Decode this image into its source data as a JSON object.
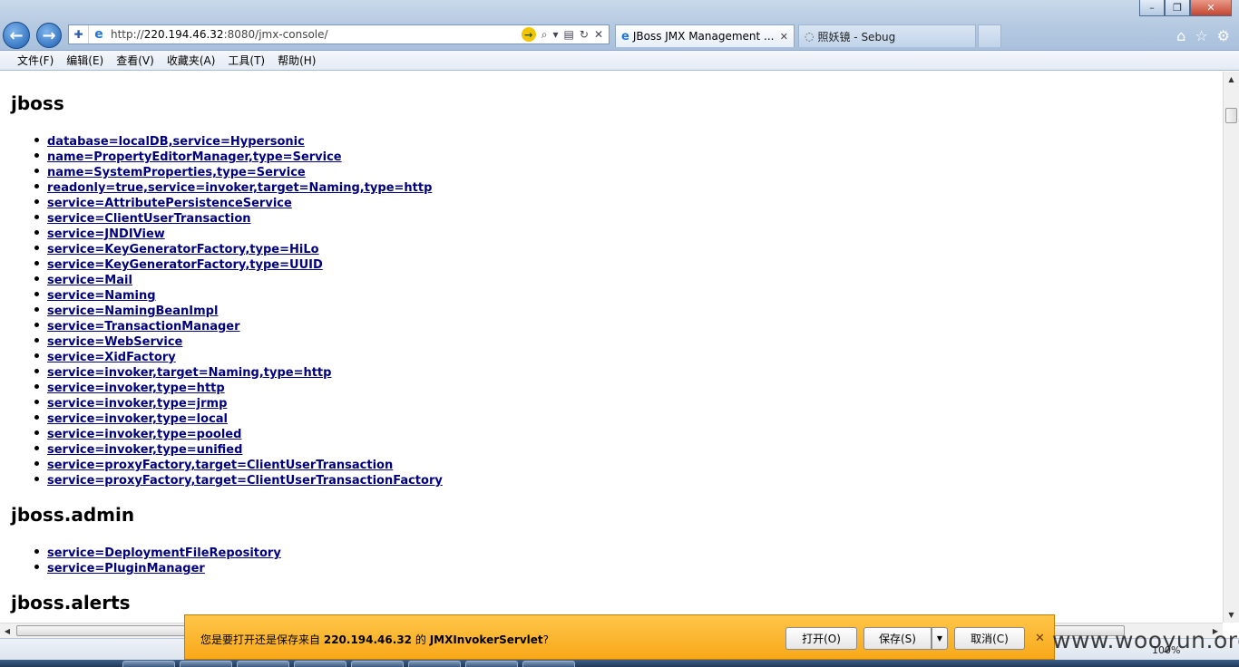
{
  "browser": {
    "address_url_prefix": "http://",
    "address_url_host": "220.194.46.32",
    "address_url_rest": ":8080/jmx-console/",
    "tabs": [
      {
        "label": "JBoss JMX Management ..."
      },
      {
        "label": "照妖镜 - Sebug"
      }
    ],
    "window_controls": {
      "minimize": "–",
      "restore": "❐",
      "close": "✕"
    }
  },
  "menu": {
    "items": [
      {
        "label": "文件(F)"
      },
      {
        "label": "编辑(E)"
      },
      {
        "label": "查看(V)"
      },
      {
        "label": "收藏夹(A)"
      },
      {
        "label": "工具(T)"
      },
      {
        "label": "帮助(H)"
      }
    ]
  },
  "content": {
    "sections": [
      {
        "title": "jboss",
        "items": [
          "database=localDB,service=Hypersonic",
          "name=PropertyEditorManager,type=Service",
          "name=SystemProperties,type=Service",
          "readonly=true,service=invoker,target=Naming,type=http",
          "service=AttributePersistenceService",
          "service=ClientUserTransaction",
          "service=JNDIView",
          "service=KeyGeneratorFactory,type=HiLo",
          "service=KeyGeneratorFactory,type=UUID",
          "service=Mail",
          "service=Naming",
          "service=NamingBeanImpl",
          "service=TransactionManager",
          "service=WebService",
          "service=XidFactory",
          "service=invoker,target=Naming,type=http",
          "service=invoker,type=http",
          "service=invoker,type=jrmp",
          "service=invoker,type=local",
          "service=invoker,type=pooled",
          "service=invoker,type=unified",
          "service=proxyFactory,target=ClientUserTransaction",
          "service=proxyFactory,target=ClientUserTransactionFactory"
        ]
      },
      {
        "title": "jboss.admin",
        "items": [
          "service=DeploymentFileRepository",
          "service=PluginManager"
        ]
      },
      {
        "title": "jboss.alerts",
        "items": []
      }
    ]
  },
  "notification": {
    "text_before": "您是要打开还是保存来自",
    "host": "220.194.46.32",
    "text_middle": "的",
    "filename": "JMXInvokerServlet",
    "text_after": "?",
    "open_label": "打开(O)",
    "save_label": "保存(S)",
    "cancel_label": "取消(C)"
  },
  "statusbar": {
    "zoom": "100%"
  },
  "watermark": "www.wooyun.org",
  "colors": {
    "link": "#00007f",
    "notify_bg": "#f8a81a"
  }
}
